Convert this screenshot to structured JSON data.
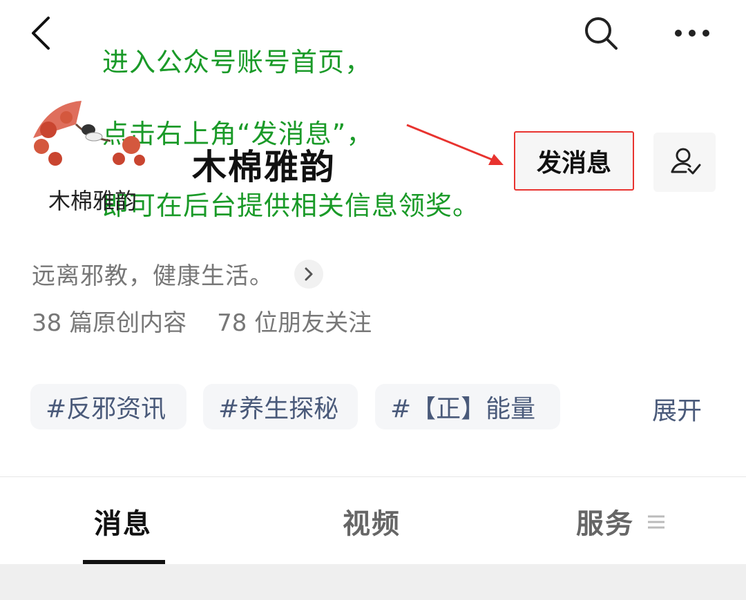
{
  "annotation": {
    "line1": "进入公众号账号首页，",
    "line2": "点击右上角“发消息”，",
    "line3": "即可在后台提供相关信息领奖。"
  },
  "account": {
    "name": "木棉雅韵",
    "avatar_text": "木棉雅韵",
    "send_message_label": "发消息",
    "description": "远离邪教，健康生活。",
    "original_count": "38 篇原创内容",
    "followers": "78 位朋友关注"
  },
  "tags": [
    "#反邪资讯",
    "#养生探秘",
    "#【正】能量"
  ],
  "expand_label": "展开",
  "tabs": [
    {
      "label": "消息",
      "active": true
    },
    {
      "label": "视频",
      "active": false
    },
    {
      "label": "服务",
      "active": false
    }
  ],
  "colors": {
    "annotation_green": "#1a9a28",
    "highlight_red": "#e8332f",
    "tag_text": "#4a5a7a"
  },
  "icons": [
    "back-icon",
    "search-icon",
    "more-icon",
    "follow-status-icon",
    "chevron-right-icon",
    "menu-icon"
  ]
}
